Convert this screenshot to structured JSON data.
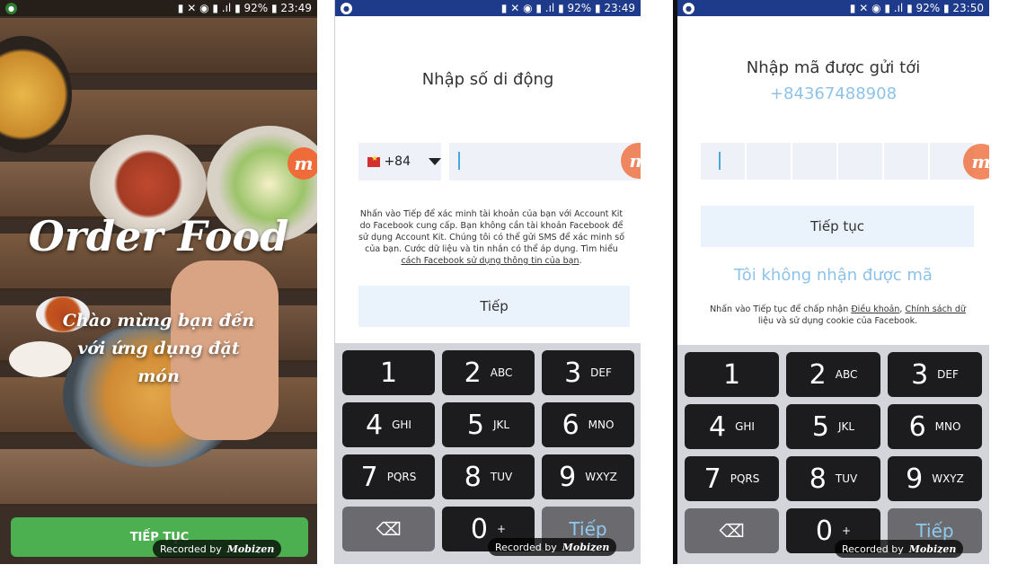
{
  "status": {
    "s1": {
      "time": "23:49",
      "battery": "92%"
    },
    "s2": {
      "time": "23:49",
      "battery": "92%"
    },
    "s3": {
      "time": "23:50",
      "battery": "92%"
    }
  },
  "screen1": {
    "title": "Order Food",
    "subtitle_lines": [
      "Chào mừng bạn đến",
      "với ứng dụng đặt",
      "món"
    ],
    "cta": "TIẾP TỤC"
  },
  "screen2": {
    "heading": "Nhập số di động",
    "country_code": "+84",
    "disclaimer": "Nhấn vào Tiếp để xác minh tài khoản của bạn với Account Kit do Facebook cung cấp. Bạn không cần tài khoản Facebook để sử dụng Account Kit. Chúng tôi có thể gửi SMS để xác minh số của bạn. Cước dữ liệu và tin nhắn có thể áp dụng. Tìm hiểu",
    "disclaimer_link": "cách Facebook sử dụng thông tin của bạn",
    "next_button": "Tiếp"
  },
  "screen3": {
    "heading": "Nhập mã được gửi tới",
    "phone": "+84367488908",
    "continue_button": "Tiếp tục",
    "resend_link": "Tôi không nhận được mã",
    "terms_prefix": "Nhấn vào Tiếp tục để chấp nhận",
    "terms_link1": "Điều khoản",
    "terms_link2": "Chính sách dữ",
    "terms_suffix": "liệu và sử dụng cookie của Facebook."
  },
  "keypad": {
    "keys": [
      {
        "d": "1",
        "l": ""
      },
      {
        "d": "2",
        "l": "ABC"
      },
      {
        "d": "3",
        "l": "DEF"
      },
      {
        "d": "4",
        "l": "GHI"
      },
      {
        "d": "5",
        "l": "JKL"
      },
      {
        "d": "6",
        "l": "MNO"
      },
      {
        "d": "7",
        "l": "PQRS"
      },
      {
        "d": "8",
        "l": "TUV"
      },
      {
        "d": "9",
        "l": "WXYZ"
      },
      {
        "d": "⌫",
        "l": ""
      },
      {
        "d": "0",
        "l": "+"
      },
      {
        "d": "Tiếp",
        "l": ""
      }
    ],
    "go_label_s3": "Tiếp"
  },
  "recorded": {
    "text": "Recorded by",
    "brand": "Mobizen"
  },
  "logo_letter": "m"
}
